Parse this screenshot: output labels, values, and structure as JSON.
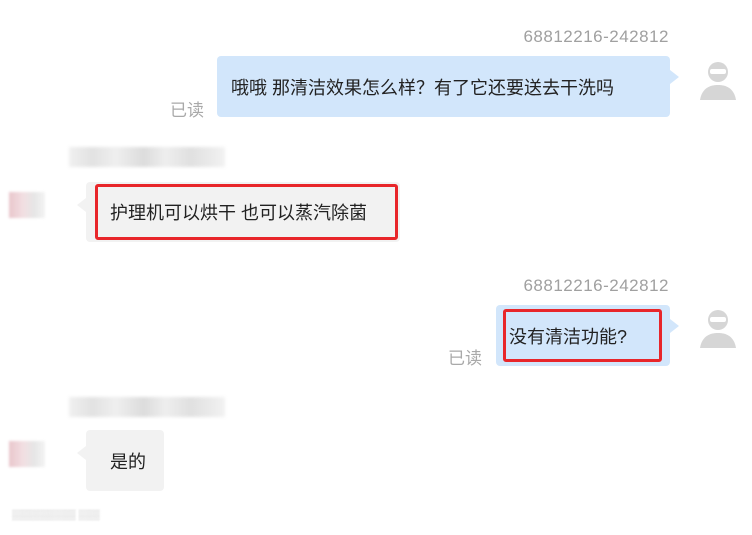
{
  "messages": [
    {
      "direction": "outgoing",
      "sender_id": "68812216-242812",
      "text": "哦哦 那清洁效果怎么样？有了它还要送去干洗吗",
      "read_status": "已读",
      "highlighted": false
    },
    {
      "direction": "incoming",
      "text": "护理机可以烘干 也可以蒸汽除菌",
      "highlighted": true
    },
    {
      "direction": "outgoing",
      "sender_id": "68812216-242812",
      "text": "没有清洁功能?",
      "read_status": "已读",
      "highlighted": true
    },
    {
      "direction": "incoming",
      "text": "是的",
      "highlighted": false
    }
  ],
  "colors": {
    "outgoing_bubble": "#d2e6fb",
    "incoming_bubble": "#f2f2f2",
    "highlight_border": "#e8262a",
    "meta_text": "#a0a0a0"
  },
  "icons": {
    "agent_avatar": "user-silhouette-icon",
    "customer_avatar": "blurred-avatar"
  }
}
